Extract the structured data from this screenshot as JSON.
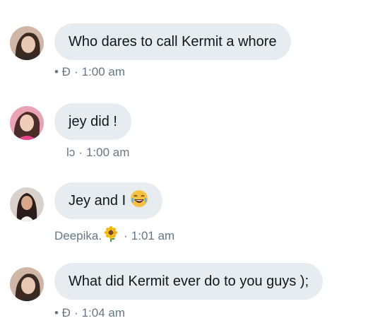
{
  "messages": [
    {
      "text": "Who dares to call Kermit a whore",
      "sender": "• Ð",
      "separator": "·",
      "time": "1:00 am"
    },
    {
      "text": "jey did !",
      "sender": "lↄ",
      "separator": "·",
      "time": "1:00 am"
    },
    {
      "text": "Jey and I",
      "emoji": "😂",
      "sender": "Deepika.",
      "sender_emoji": "🌻",
      "separator": "·",
      "time": "1:01 am"
    },
    {
      "text": "What did Kermit ever do to you guys );",
      "sender": "• Ð",
      "separator": "·",
      "time": "1:04 am"
    }
  ],
  "colors": {
    "bubble": "#e6ecf0",
    "meta_text": "#657786",
    "message_text": "#14171a",
    "emoji_face": "#f6c244"
  }
}
